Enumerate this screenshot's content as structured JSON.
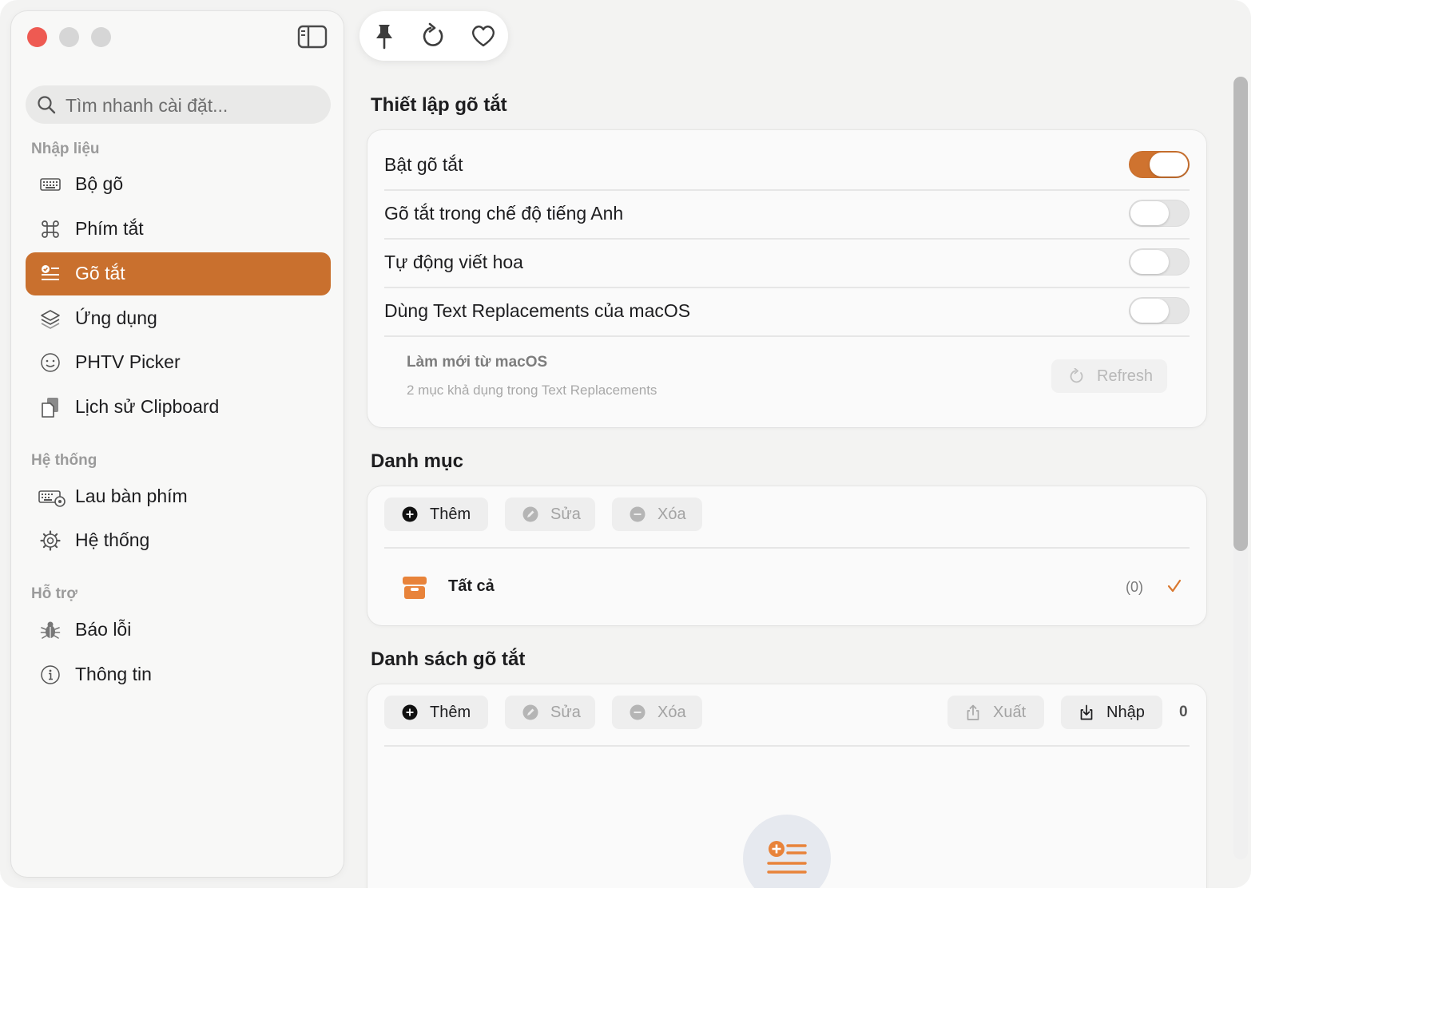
{
  "sidebar": {
    "search_placeholder": "Tìm nhanh cài đặt...",
    "sections": [
      {
        "header": "Nhập liệu",
        "items": [
          {
            "label": "Bộ gõ",
            "icon": "keyboard-icon",
            "active": false
          },
          {
            "label": "Phím tắt",
            "icon": "command-icon",
            "active": false
          },
          {
            "label": "Gõ tắt",
            "icon": "text-checklist-icon",
            "active": true
          },
          {
            "label": "Ứng dụng",
            "icon": "layers-icon",
            "active": false
          },
          {
            "label": "PHTV Picker",
            "icon": "smiley-icon",
            "active": false
          },
          {
            "label": "Lịch sử Clipboard",
            "icon": "clipboard-icon",
            "active": false
          }
        ]
      },
      {
        "header": "Hệ thống",
        "items": [
          {
            "label": "Lau bàn phím",
            "icon": "keyboard-clean-icon",
            "active": false
          },
          {
            "label": "Hệ thống",
            "icon": "gear-icon",
            "active": false
          }
        ]
      },
      {
        "header": "Hỗ trợ",
        "items": [
          {
            "label": "Báo lỗi",
            "icon": "bug-icon",
            "active": false
          },
          {
            "label": "Thông tin",
            "icon": "info-icon",
            "active": false
          }
        ]
      }
    ]
  },
  "toolbar": {
    "icons": [
      "pin-icon",
      "refresh-icon",
      "heart-icon"
    ]
  },
  "settings": {
    "title": "Thiết lập gõ tắt",
    "rows": [
      {
        "label": "Bật gõ tắt",
        "on": true
      },
      {
        "label": "Gõ tắt trong chế độ tiếng Anh",
        "on": false
      },
      {
        "label": "Tự động viết hoa",
        "on": false
      },
      {
        "label": "Dùng Text Replacements của macOS",
        "on": false
      }
    ],
    "refresh_title": "Làm mới từ macOS",
    "refresh_desc": "2 mục khả dụng trong Text Replacements",
    "refresh_button": "Refresh"
  },
  "categories": {
    "title": "Danh mục",
    "add": "Thêm",
    "edit": "Sửa",
    "delete": "Xóa",
    "item_label": "Tất cả",
    "item_count": "(0)"
  },
  "shortcuts": {
    "title": "Danh sách gõ tắt",
    "add": "Thêm",
    "edit": "Sửa",
    "delete": "Xóa",
    "export": "Xuất",
    "import": "Nhập",
    "count": "0"
  },
  "colors": {
    "accent": "#c9702e",
    "close": "#ee5a52"
  }
}
